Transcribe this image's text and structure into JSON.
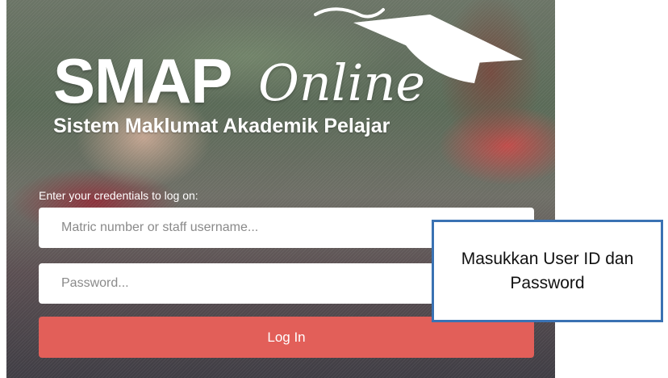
{
  "branding": {
    "title_main": "SMAP",
    "title_script": "Online",
    "subtitle": "Sistem Maklumat Akademik Pelajar"
  },
  "login_form": {
    "instruction": "Enter your credentials to log on:",
    "username_placeholder": "Matric number or staff username...",
    "password_placeholder": "Password...",
    "submit_label": "Log In"
  },
  "annotation": {
    "text": "Masukkan User ID dan Password"
  },
  "colors": {
    "button": "#e25f59",
    "callout_border": "#3a72b3"
  },
  "icons": [
    "graduation-cap-icon"
  ]
}
